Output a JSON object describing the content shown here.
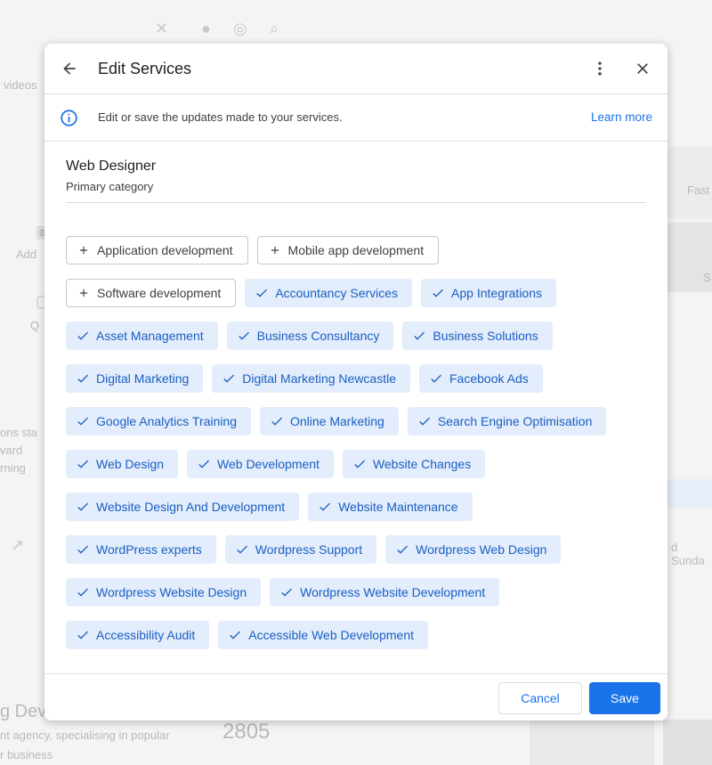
{
  "background": {
    "items": [
      {
        "text": "videos",
        "kind": "text"
      },
      {
        "text": "Add",
        "kind": "text"
      },
      {
        "text": "Q",
        "kind": "text"
      },
      {
        "text": "ons sta",
        "kind": "text"
      },
      {
        "text": "vard",
        "kind": "text"
      },
      {
        "text": "rning",
        "kind": "text"
      },
      {
        "text": "Fast",
        "kind": "text"
      },
      {
        "text": "S",
        "kind": "text"
      },
      {
        "text": "d Sunda",
        "kind": "text"
      },
      {
        "text": "g Deve",
        "kind": "text"
      },
      {
        "text": "nt agency, specialising in popular",
        "kind": "text"
      },
      {
        "text": "r business",
        "kind": "text"
      },
      {
        "text": "2805",
        "kind": "text"
      }
    ]
  },
  "modal": {
    "title": "Edit Services",
    "back_icon": "arrow-back-icon",
    "more_icon": "more-vert-icon",
    "close_icon": "close-icon",
    "info": {
      "icon": "info-icon",
      "text": "Edit or save the updates made to your services.",
      "link": "Learn more"
    },
    "primary_category": {
      "name": "Web Designer",
      "label": "Primary category"
    },
    "rows": [
      [
        {
          "label": "Application development",
          "selected": false
        },
        {
          "label": "Mobile app development",
          "selected": false
        }
      ],
      [
        {
          "label": "Software development",
          "selected": false
        },
        {
          "label": "Accountancy Services",
          "selected": true
        },
        {
          "label": "App Integrations",
          "selected": true
        }
      ],
      [
        {
          "label": "Asset Management",
          "selected": true
        },
        {
          "label": "Business Consultancy",
          "selected": true
        },
        {
          "label": "Business Solutions",
          "selected": true
        }
      ],
      [
        {
          "label": "Digital Marketing",
          "selected": true
        },
        {
          "label": "Digital Marketing Newcastle",
          "selected": true
        },
        {
          "label": "Facebook Ads",
          "selected": true
        }
      ],
      [
        {
          "label": "Google Analytics Training",
          "selected": true
        },
        {
          "label": "Online Marketing",
          "selected": true
        },
        {
          "label": "Search Engine Optimisation",
          "selected": true
        }
      ],
      [
        {
          "label": "Web Design",
          "selected": true
        },
        {
          "label": "Web Development",
          "selected": true
        },
        {
          "label": "Website Changes",
          "selected": true
        }
      ],
      [
        {
          "label": "Website Design And Development",
          "selected": true
        },
        {
          "label": "Website Maintenance",
          "selected": true
        }
      ],
      [
        {
          "label": "WordPress experts",
          "selected": true
        },
        {
          "label": "Wordpress Support",
          "selected": true
        },
        {
          "label": "Wordpress Web Design",
          "selected": true
        }
      ],
      [
        {
          "label": "Wordpress Website Design",
          "selected": true
        },
        {
          "label": "Wordpress Website Development",
          "selected": true
        }
      ],
      [
        {
          "label": "Accessibility Audit",
          "selected": true
        },
        {
          "label": "Accessible Web Development",
          "selected": true
        }
      ]
    ],
    "footer": {
      "cancel": "Cancel",
      "save": "Save"
    }
  },
  "colors": {
    "accent": "#1a73e8",
    "chip_selected_bg": "#e3edfb",
    "chip_selected_text": "#1a5fc4"
  }
}
